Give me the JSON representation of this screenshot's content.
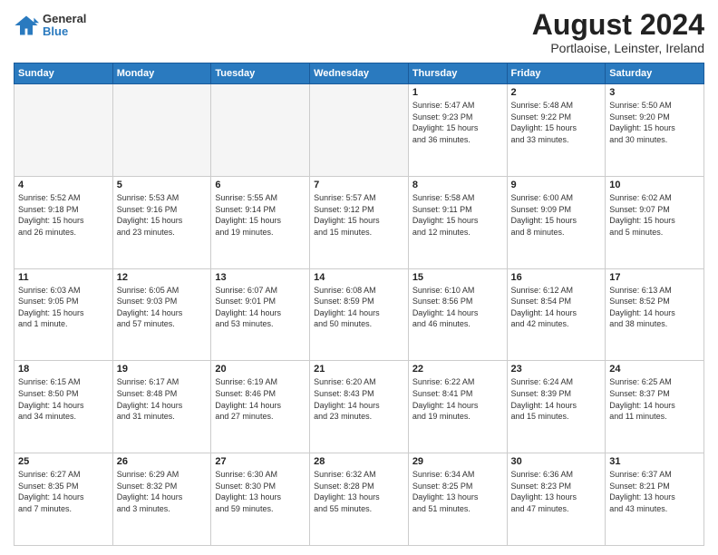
{
  "header": {
    "logo": {
      "general": "General",
      "blue": "Blue"
    },
    "title": "August 2024",
    "subtitle": "Portlaoise, Leinster, Ireland"
  },
  "days_of_week": [
    "Sunday",
    "Monday",
    "Tuesday",
    "Wednesday",
    "Thursday",
    "Friday",
    "Saturday"
  ],
  "weeks": [
    [
      {
        "day": "",
        "info": ""
      },
      {
        "day": "",
        "info": ""
      },
      {
        "day": "",
        "info": ""
      },
      {
        "day": "",
        "info": ""
      },
      {
        "day": "1",
        "info": "Sunrise: 5:47 AM\nSunset: 9:23 PM\nDaylight: 15 hours\nand 36 minutes."
      },
      {
        "day": "2",
        "info": "Sunrise: 5:48 AM\nSunset: 9:22 PM\nDaylight: 15 hours\nand 33 minutes."
      },
      {
        "day": "3",
        "info": "Sunrise: 5:50 AM\nSunset: 9:20 PM\nDaylight: 15 hours\nand 30 minutes."
      }
    ],
    [
      {
        "day": "4",
        "info": "Sunrise: 5:52 AM\nSunset: 9:18 PM\nDaylight: 15 hours\nand 26 minutes."
      },
      {
        "day": "5",
        "info": "Sunrise: 5:53 AM\nSunset: 9:16 PM\nDaylight: 15 hours\nand 23 minutes."
      },
      {
        "day": "6",
        "info": "Sunrise: 5:55 AM\nSunset: 9:14 PM\nDaylight: 15 hours\nand 19 minutes."
      },
      {
        "day": "7",
        "info": "Sunrise: 5:57 AM\nSunset: 9:12 PM\nDaylight: 15 hours\nand 15 minutes."
      },
      {
        "day": "8",
        "info": "Sunrise: 5:58 AM\nSunset: 9:11 PM\nDaylight: 15 hours\nand 12 minutes."
      },
      {
        "day": "9",
        "info": "Sunrise: 6:00 AM\nSunset: 9:09 PM\nDaylight: 15 hours\nand 8 minutes."
      },
      {
        "day": "10",
        "info": "Sunrise: 6:02 AM\nSunset: 9:07 PM\nDaylight: 15 hours\nand 5 minutes."
      }
    ],
    [
      {
        "day": "11",
        "info": "Sunrise: 6:03 AM\nSunset: 9:05 PM\nDaylight: 15 hours\nand 1 minute."
      },
      {
        "day": "12",
        "info": "Sunrise: 6:05 AM\nSunset: 9:03 PM\nDaylight: 14 hours\nand 57 minutes."
      },
      {
        "day": "13",
        "info": "Sunrise: 6:07 AM\nSunset: 9:01 PM\nDaylight: 14 hours\nand 53 minutes."
      },
      {
        "day": "14",
        "info": "Sunrise: 6:08 AM\nSunset: 8:59 PM\nDaylight: 14 hours\nand 50 minutes."
      },
      {
        "day": "15",
        "info": "Sunrise: 6:10 AM\nSunset: 8:56 PM\nDaylight: 14 hours\nand 46 minutes."
      },
      {
        "day": "16",
        "info": "Sunrise: 6:12 AM\nSunset: 8:54 PM\nDaylight: 14 hours\nand 42 minutes."
      },
      {
        "day": "17",
        "info": "Sunrise: 6:13 AM\nSunset: 8:52 PM\nDaylight: 14 hours\nand 38 minutes."
      }
    ],
    [
      {
        "day": "18",
        "info": "Sunrise: 6:15 AM\nSunset: 8:50 PM\nDaylight: 14 hours\nand 34 minutes."
      },
      {
        "day": "19",
        "info": "Sunrise: 6:17 AM\nSunset: 8:48 PM\nDaylight: 14 hours\nand 31 minutes."
      },
      {
        "day": "20",
        "info": "Sunrise: 6:19 AM\nSunset: 8:46 PM\nDaylight: 14 hours\nand 27 minutes."
      },
      {
        "day": "21",
        "info": "Sunrise: 6:20 AM\nSunset: 8:43 PM\nDaylight: 14 hours\nand 23 minutes."
      },
      {
        "day": "22",
        "info": "Sunrise: 6:22 AM\nSunset: 8:41 PM\nDaylight: 14 hours\nand 19 minutes."
      },
      {
        "day": "23",
        "info": "Sunrise: 6:24 AM\nSunset: 8:39 PM\nDaylight: 14 hours\nand 15 minutes."
      },
      {
        "day": "24",
        "info": "Sunrise: 6:25 AM\nSunset: 8:37 PM\nDaylight: 14 hours\nand 11 minutes."
      }
    ],
    [
      {
        "day": "25",
        "info": "Sunrise: 6:27 AM\nSunset: 8:35 PM\nDaylight: 14 hours\nand 7 minutes."
      },
      {
        "day": "26",
        "info": "Sunrise: 6:29 AM\nSunset: 8:32 PM\nDaylight: 14 hours\nand 3 minutes."
      },
      {
        "day": "27",
        "info": "Sunrise: 6:30 AM\nSunset: 8:30 PM\nDaylight: 13 hours\nand 59 minutes."
      },
      {
        "day": "28",
        "info": "Sunrise: 6:32 AM\nSunset: 8:28 PM\nDaylight: 13 hours\nand 55 minutes."
      },
      {
        "day": "29",
        "info": "Sunrise: 6:34 AM\nSunset: 8:25 PM\nDaylight: 13 hours\nand 51 minutes."
      },
      {
        "day": "30",
        "info": "Sunrise: 6:36 AM\nSunset: 8:23 PM\nDaylight: 13 hours\nand 47 minutes."
      },
      {
        "day": "31",
        "info": "Sunrise: 6:37 AM\nSunset: 8:21 PM\nDaylight: 13 hours\nand 43 minutes."
      }
    ]
  ]
}
